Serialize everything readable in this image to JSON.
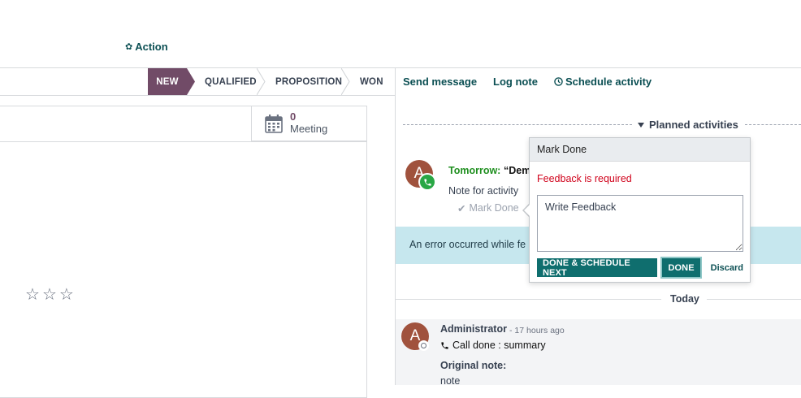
{
  "header": {
    "action_label": "Action",
    "action_icon": "gear-icon"
  },
  "statusbar": {
    "stages": [
      "NEW",
      "QUALIFIED",
      "PROPOSITION",
      "WON"
    ],
    "active_stage": "NEW",
    "active_color": "#714B67"
  },
  "form": {
    "meeting_button": {
      "count": "0",
      "label": "Meeting",
      "icon": "calendar-icon"
    },
    "priority_stars": 3
  },
  "chatter": {
    "actions": {
      "send_message": "Send message",
      "log_note": "Log note",
      "schedule_activity": "Schedule activity"
    },
    "planned_title": "Planned activities",
    "activity": {
      "avatar_letter": "A",
      "when": "Tomorrow:",
      "summary": "“Dem",
      "note": "Note for activity",
      "mark_done": "Mark Done"
    },
    "error_banner": "An error occurred while fe",
    "today_label": "Today",
    "message": {
      "avatar_letter": "A",
      "author": "Administrator",
      "time": "- 17 hours ago",
      "body": "Call done : summary",
      "original_note_label": "Original note:",
      "original_note": "note"
    }
  },
  "popover": {
    "title": "Mark Done",
    "error": "Feedback is required",
    "feedback_value": "Write Feedback",
    "buttons": {
      "done_schedule_next": "DONE & SCHEDULE NEXT",
      "done": "DONE",
      "discard": "Discard"
    }
  },
  "colors": {
    "accent": "#0b4f53",
    "primary_button": "#0f6e6e",
    "brand": "#714B67",
    "error": "#d0021b",
    "info_banner": "#c6e7ee",
    "avatar": "#a0523d",
    "phone_badge": "#28a745"
  }
}
